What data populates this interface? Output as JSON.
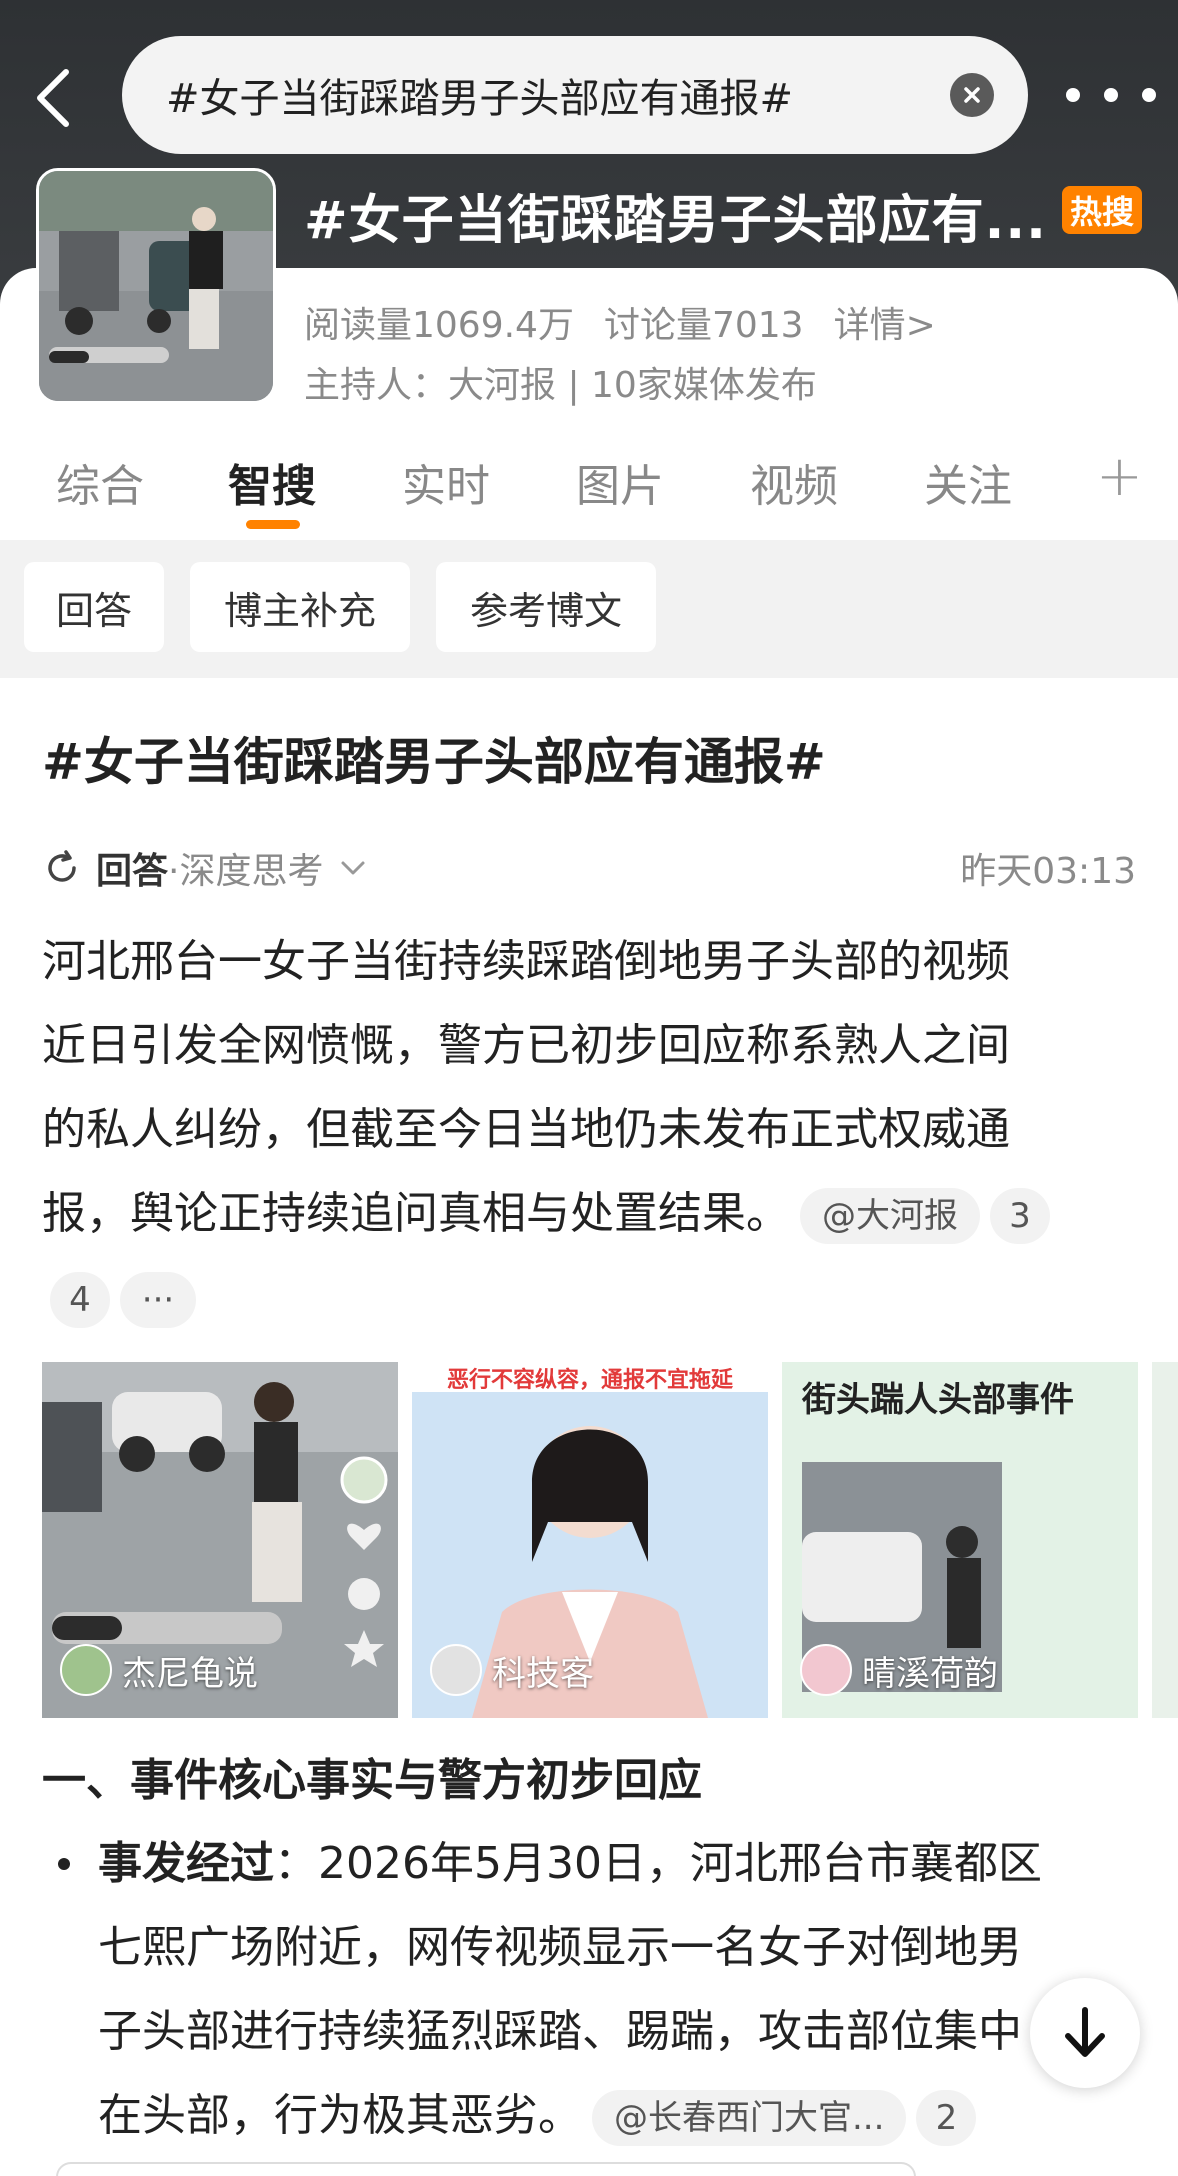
{
  "search": {
    "query": "#女子当街踩踏男子头部应有通报#"
  },
  "topic": {
    "title": "#女子当街踩踏男子头部应有...",
    "badge": "热搜",
    "reads": "阅读量1069.4万",
    "discussions": "讨论量7013",
    "details_link": "详情>",
    "host": "主持人：大河报 | 10家媒体发布"
  },
  "tabs": [
    {
      "label": "综合"
    },
    {
      "label": "智搜"
    },
    {
      "label": "实时"
    },
    {
      "label": "图片"
    },
    {
      "label": "视频"
    },
    {
      "label": "关注"
    }
  ],
  "tab_add": "+",
  "chips": [
    "回答",
    "博主补充",
    "参考博文"
  ],
  "content": {
    "title": "#女子当街踩踏男子头部应有通报#",
    "answer_label": "回答",
    "answer_mode": "·深度思考",
    "time": "昨天03:13",
    "paragraph_lines": [
      "河北邢台一女子当街持续踩踏倒地男子头部的视频",
      "近日引发全网愤慨，警方已初步回应称系熟人之间",
      "的私人纠纷，但截至今日当地仍未发布正式权威通",
      "报，舆论正持续追问真相与处置结果。"
    ],
    "ref_source": "@大河报",
    "ref_num_1": "3",
    "ref_num_2": "4",
    "ref_more": "···",
    "media": [
      {
        "author": "杰尼龟说"
      },
      {
        "author": "科技客",
        "caption_top": "恶行不容纵容，通报不宜拖延"
      },
      {
        "author": "晴溪荷韵",
        "caption_top": "街头踹人头部事件"
      }
    ],
    "section_heading": "一、事件核心事实与警方初步回应",
    "bullet_title": "事发经过",
    "bullet_lines": [
      "：2026年5月30日，河北邢台市襄都区",
      "七熙广场附近，网传视频显示一名女子对倒地男",
      "子头部进行持续猛烈踩踏、踢踹，攻击部位集中",
      "在头部，行为极其恶劣。"
    ],
    "bullet_ref": "@长春西门大官...",
    "bullet_ref_num": "2"
  }
}
